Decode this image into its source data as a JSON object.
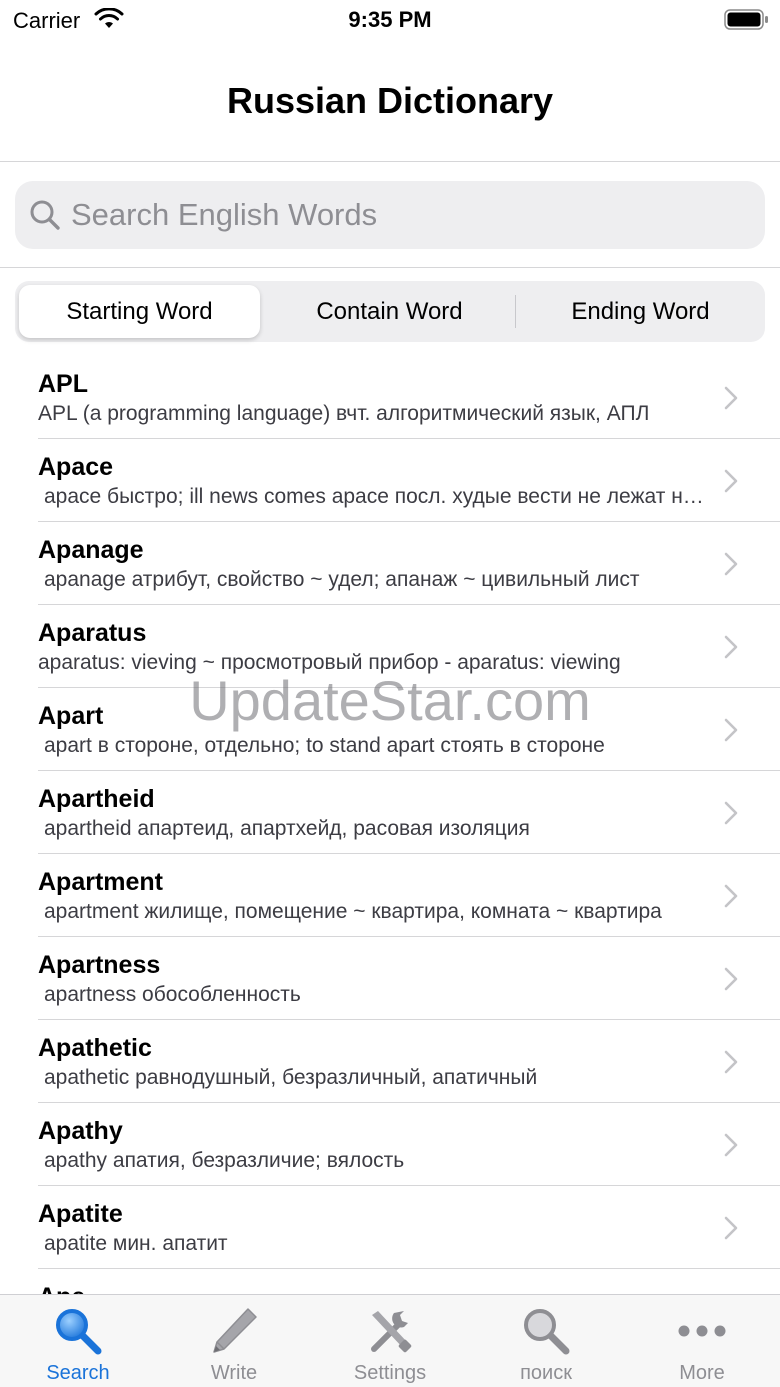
{
  "status_bar": {
    "carrier": "Carrier",
    "time": "9:35 PM"
  },
  "nav": {
    "title": "Russian Dictionary"
  },
  "search": {
    "placeholder": "Search English Words",
    "value": ""
  },
  "segments": [
    {
      "label": "Starting Word",
      "selected": true
    },
    {
      "label": "Contain Word",
      "selected": false
    },
    {
      "label": "Ending Word",
      "selected": false
    }
  ],
  "entries": [
    {
      "word": "APL",
      "definition": "APL (a programming language) вчт. алгоритмический язык, АПЛ"
    },
    {
      "word": "Apace",
      "definition": "apace быстро; ill news comes apace посл. худые вести не лежат на месте"
    },
    {
      "word": "Apanage",
      "definition": "apanage атрибут, свойство ~ удел; апанаж ~ цивильный лист"
    },
    {
      "word": "Aparatus",
      "definition": "aparatus: vieving ~ просмотровый прибор - aparatus: viewing"
    },
    {
      "word": "Apart",
      "definition": "apart в стороне, отдельно; to stand apart стоять в стороне"
    },
    {
      "word": "Apartheid",
      "definition": "apartheid апартеид, апартхейд, расовая изоляция"
    },
    {
      "word": "Apartment",
      "definition": "apartment жилище, помещение ~ квартира, комната ~ квартира"
    },
    {
      "word": "Apartness",
      "definition": "apartness обособленность"
    },
    {
      "word": "Apathetic",
      "definition": "apathetic равнодушный, безразличный, апатичный"
    },
    {
      "word": "Apathy",
      "definition": "apathy апатия, безразличие; вялость"
    },
    {
      "word": "Apatite",
      "definition": "apatite мин. апатит"
    },
    {
      "word": "Ape",
      "definition": ""
    }
  ],
  "watermark": "UpdateStar.com",
  "tabs": [
    {
      "label": "Search",
      "icon": "magnifier-icon",
      "active": true
    },
    {
      "label": "Write",
      "icon": "pencil-icon",
      "active": false
    },
    {
      "label": "Settings",
      "icon": "tools-icon",
      "active": false
    },
    {
      "label": "поиск",
      "icon": "magnifier-icon",
      "active": false
    },
    {
      "label": "More",
      "icon": "more-dots-icon",
      "active": false
    }
  ],
  "colors": {
    "accent": "#1a73d9",
    "inactive": "#8e8e93",
    "separator": "#d6d6d8"
  }
}
